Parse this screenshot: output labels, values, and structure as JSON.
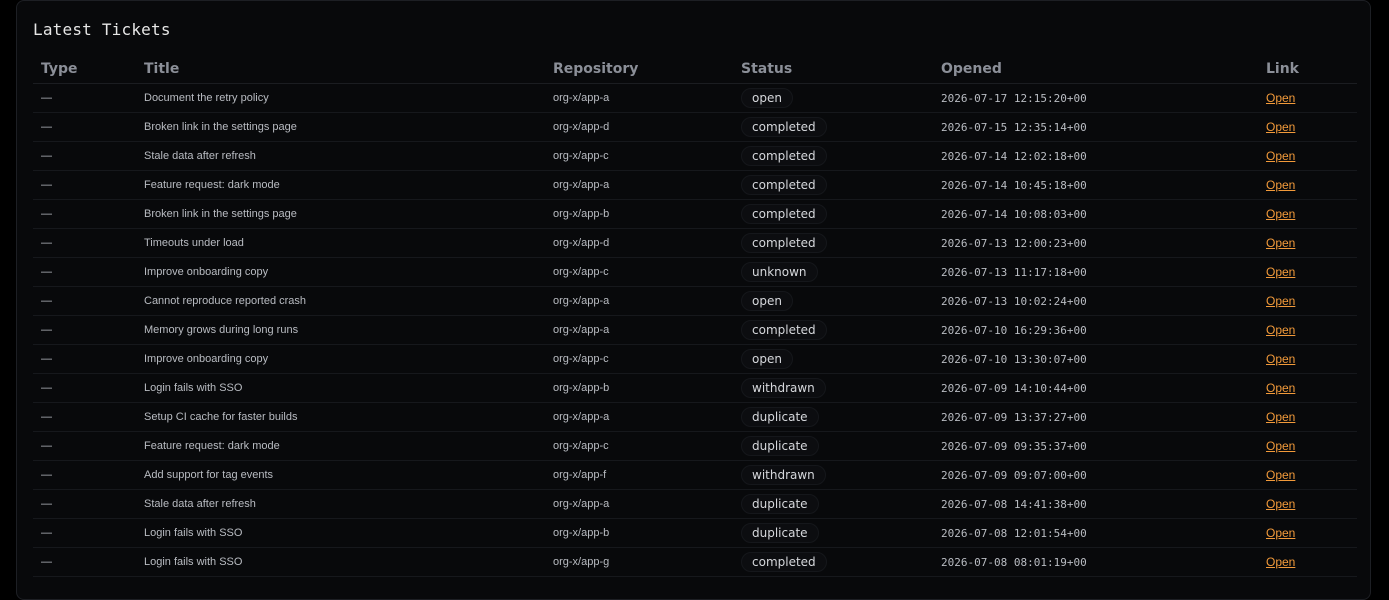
{
  "panel": {
    "title": "Latest Tickets"
  },
  "columns": [
    "Type",
    "Title",
    "Repository",
    "Status",
    "Opened",
    "Link"
  ],
  "rows": [
    {
      "type": "—",
      "title": "Document the retry policy",
      "repo": "org-x/app-a",
      "status": "open",
      "opened": "2026-07-17 12:15:20+00",
      "link": "Open"
    },
    {
      "type": "—",
      "title": "Broken link in the settings page",
      "repo": "org-x/app-d",
      "status": "completed",
      "opened": "2026-07-15 12:35:14+00",
      "link": "Open"
    },
    {
      "type": "—",
      "title": "Stale data after refresh",
      "repo": "org-x/app-c",
      "status": "completed",
      "opened": "2026-07-14 12:02:18+00",
      "link": "Open"
    },
    {
      "type": "—",
      "title": "Feature request: dark mode",
      "repo": "org-x/app-a",
      "status": "completed",
      "opened": "2026-07-14 10:45:18+00",
      "link": "Open"
    },
    {
      "type": "—",
      "title": "Broken link in the settings page",
      "repo": "org-x/app-b",
      "status": "completed",
      "opened": "2026-07-14 10:08:03+00",
      "link": "Open"
    },
    {
      "type": "—",
      "title": "Timeouts under load",
      "repo": "org-x/app-d",
      "status": "completed",
      "opened": "2026-07-13 12:00:23+00",
      "link": "Open"
    },
    {
      "type": "—",
      "title": "Improve onboarding copy",
      "repo": "org-x/app-c",
      "status": "unknown",
      "opened": "2026-07-13 11:17:18+00",
      "link": "Open"
    },
    {
      "type": "—",
      "title": "Cannot reproduce reported crash",
      "repo": "org-x/app-a",
      "status": "open",
      "opened": "2026-07-13 10:02:24+00",
      "link": "Open"
    },
    {
      "type": "—",
      "title": "Memory grows during long runs",
      "repo": "org-x/app-a",
      "status": "completed",
      "opened": "2026-07-10 16:29:36+00",
      "link": "Open"
    },
    {
      "type": "—",
      "title": "Improve onboarding copy",
      "repo": "org-x/app-c",
      "status": "open",
      "opened": "2026-07-10 13:30:07+00",
      "link": "Open"
    },
    {
      "type": "—",
      "title": "Login fails with SSO",
      "repo": "org-x/app-b",
      "status": "withdrawn",
      "opened": "2026-07-09 14:10:44+00",
      "link": "Open"
    },
    {
      "type": "—",
      "title": "Setup CI cache for faster builds",
      "repo": "org-x/app-a",
      "status": "duplicate",
      "opened": "2026-07-09 13:37:27+00",
      "link": "Open"
    },
    {
      "type": "—",
      "title": "Feature request: dark mode",
      "repo": "org-x/app-c",
      "status": "duplicate",
      "opened": "2026-07-09 09:35:37+00",
      "link": "Open"
    },
    {
      "type": "—",
      "title": "Add support for tag events",
      "repo": "org-x/app-f",
      "status": "withdrawn",
      "opened": "2026-07-09 09:07:00+00",
      "link": "Open"
    },
    {
      "type": "—",
      "title": "Stale data after refresh",
      "repo": "org-x/app-a",
      "status": "duplicate",
      "opened": "2026-07-08 14:41:38+00",
      "link": "Open"
    },
    {
      "type": "—",
      "title": "Login fails with SSO",
      "repo": "org-x/app-b",
      "status": "duplicate",
      "opened": "2026-07-08 12:01:54+00",
      "link": "Open"
    },
    {
      "type": "—",
      "title": "Login fails with SSO",
      "repo": "org-x/app-g",
      "status": "completed",
      "opened": "2026-07-08 08:01:19+00",
      "link": "Open"
    }
  ],
  "colors": {
    "background": "#000000",
    "panel": "#08090b",
    "link": "#f29a3a",
    "header_text": "#8b8f98"
  }
}
